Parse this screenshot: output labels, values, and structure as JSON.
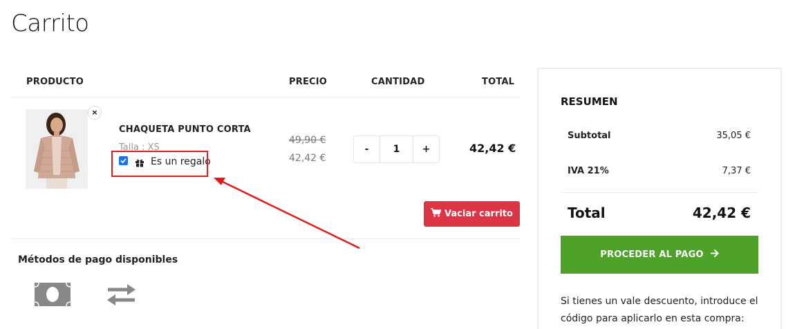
{
  "page": {
    "title": "Carrito"
  },
  "table": {
    "headers": {
      "producto": "PRODUCTO",
      "precio": "PRECIO",
      "cantidad": "CANTIDAD",
      "total": "TOTAL"
    }
  },
  "item": {
    "name": "CHAQUETA PUNTO CORTA",
    "size": "Talla : XS",
    "gift_label": "Es un regalo",
    "gift_checked": true,
    "price_old": "49,90 €",
    "price_new": "42,42 €",
    "quantity": "1",
    "qty_minus": "-",
    "qty_plus": "+",
    "total": "42,42 €",
    "remove": "×"
  },
  "actions": {
    "empty_cart": "Vaciar carrito"
  },
  "payment": {
    "title": "Métodos de pago disponibles",
    "icons": [
      "cash-icon",
      "transfer-icon"
    ]
  },
  "summary": {
    "title": "RESUMEN",
    "subtotal_label": "Subtotal",
    "subtotal_value": "35,05 €",
    "tax_label": "IVA 21%",
    "tax_value": "7,37 €",
    "total_label": "Total",
    "total_value": "42,42 €",
    "checkout": "PROCEDER AL PAGO",
    "voucher_text": "Si tienes un vale descuento, introduce el código para aplicarlo en esta compra:"
  },
  "colors": {
    "empty_button": "#dc3545",
    "checkout_button": "#4ea229",
    "annotation": "#e31a1a",
    "checkbox": "#1a73e8"
  }
}
